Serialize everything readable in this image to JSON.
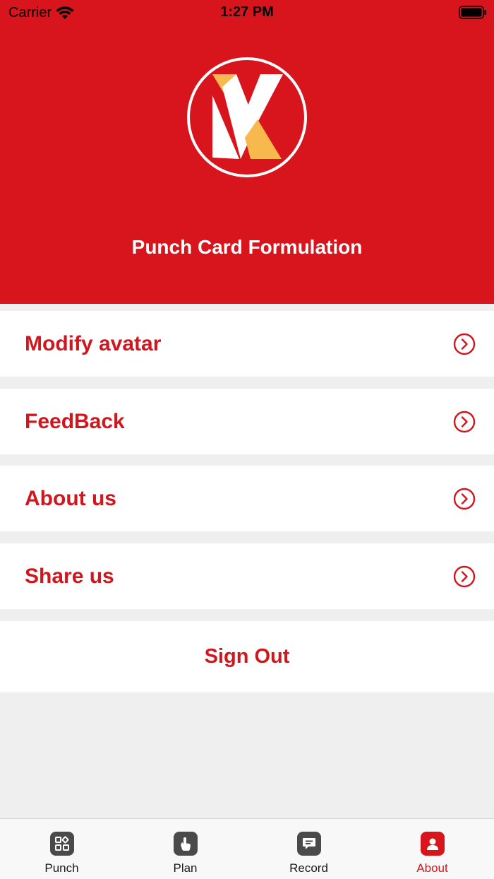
{
  "status_bar": {
    "carrier": "Carrier",
    "time": "1:27 PM"
  },
  "header": {
    "title": "Punch Card Formulation",
    "background_color": "#d8141c"
  },
  "menu": {
    "items": [
      {
        "label": "Modify avatar",
        "icon": "chevron-right-circle-icon"
      },
      {
        "label": "FeedBack",
        "icon": "chevron-right-circle-icon"
      },
      {
        "label": "About us",
        "icon": "chevron-right-circle-icon"
      },
      {
        "label": "Share us",
        "icon": "chevron-right-circle-icon"
      }
    ],
    "sign_out_label": "Sign Out",
    "accent_color": "#d2161e"
  },
  "tabbar": {
    "tabs": [
      {
        "label": "Punch",
        "icon": "grid-apps-icon",
        "active": false
      },
      {
        "label": "Plan",
        "icon": "hand-pointer-icon",
        "active": false
      },
      {
        "label": "Record",
        "icon": "message-icon",
        "active": false
      },
      {
        "label": "About",
        "icon": "person-icon",
        "active": true
      }
    ]
  }
}
